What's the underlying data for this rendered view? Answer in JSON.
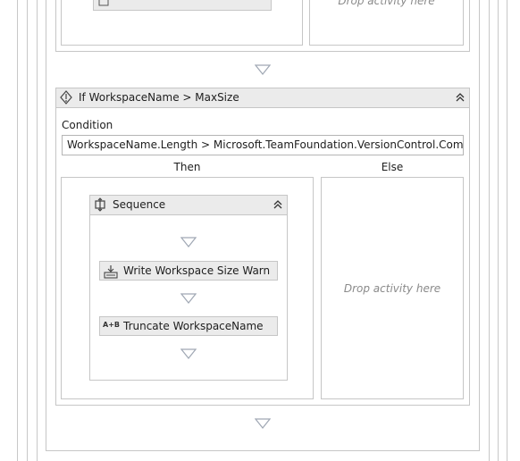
{
  "outer_if": {
    "title": "If WorkspaceName > MaxSize",
    "condition_label": "Condition",
    "condition_value": "WorkspaceName.Length > Microsoft.TeamFoundation.VersionControl.Common.Re",
    "then_label": "Then",
    "else_label": "Else",
    "else_drop_text": "Drop activity here"
  },
  "previous": {
    "drop_text": "Drop activity here"
  },
  "sequence": {
    "title": "Sequence",
    "activities": [
      {
        "label": "Write Workspace Size Warn",
        "icon": "write-line-icon"
      },
      {
        "label": "Truncate WorkspaceName",
        "icon": "assign-icon",
        "icon_text": "A+B"
      }
    ]
  },
  "colors": {
    "border": "#c6c6c6",
    "header_bg": "#ebebeb",
    "arrow": "#a0a8b4",
    "drop_text": "#8a8a8a"
  }
}
